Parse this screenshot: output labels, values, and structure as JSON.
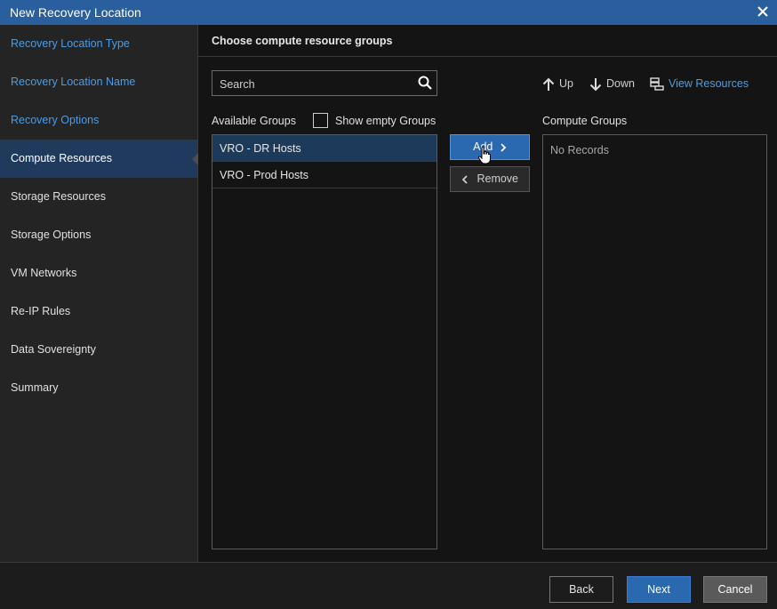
{
  "window": {
    "title": "New Recovery Location",
    "close_icon": "close-icon"
  },
  "sidebar": {
    "items": [
      {
        "label": "Recovery Location Type",
        "state": "done"
      },
      {
        "label": "Recovery Location Name",
        "state": "done"
      },
      {
        "label": "Recovery Options",
        "state": "done"
      },
      {
        "label": "Compute Resources",
        "state": "active"
      },
      {
        "label": "Storage Resources",
        "state": "pending"
      },
      {
        "label": "Storage Options",
        "state": "pending"
      },
      {
        "label": "VM Networks",
        "state": "pending"
      },
      {
        "label": "Re-IP Rules",
        "state": "pending"
      },
      {
        "label": "Data Sovereignty",
        "state": "pending"
      },
      {
        "label": "Summary",
        "state": "pending"
      }
    ]
  },
  "main": {
    "heading": "Choose compute resource groups",
    "search": {
      "placeholder": "Search",
      "value": ""
    },
    "available": {
      "label": "Available Groups",
      "show_empty_label": "Show empty Groups",
      "show_empty_checked": false,
      "rows": [
        {
          "label": "VRO - DR Hosts",
          "selected": true
        },
        {
          "label": "VRO - Prod Hosts",
          "selected": false
        }
      ]
    },
    "buttons": {
      "add": "Add",
      "remove": "Remove"
    },
    "toolbar": {
      "up": "Up",
      "down": "Down",
      "view_resources": "View Resources"
    },
    "compute": {
      "label": "Compute Groups",
      "empty_text": "No Records"
    }
  },
  "footer": {
    "back": "Back",
    "next": "Next",
    "cancel": "Cancel"
  },
  "colors": {
    "accent": "#2a68b0",
    "link": "#4a9ee8",
    "titlebar": "#2a5f9e"
  }
}
